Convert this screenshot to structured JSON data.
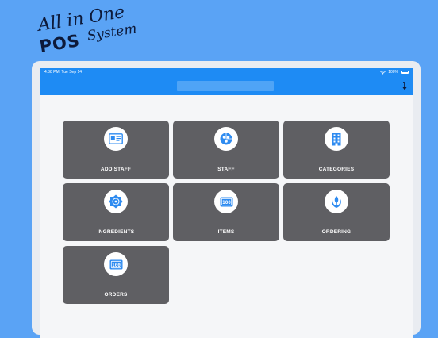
{
  "promo": {
    "line1": "All in One",
    "line2_bold": "POS",
    "line2_script": "System"
  },
  "status_bar": {
    "time": "4:38 PM",
    "date": "Tue Sep 14",
    "battery": "100%",
    "icons": [
      "wifi-icon",
      "battery-icon"
    ]
  },
  "header": {
    "title": "",
    "action_icon": "arrow-down-icon"
  },
  "colors": {
    "background": "#5AA3F5",
    "header": "#1E8BF4",
    "tile": "#5F5F63",
    "icon": "#2E8BF0"
  },
  "tiles": [
    {
      "label": "ADD STAFF",
      "icon": "id-card-icon"
    },
    {
      "label": "STAFF",
      "icon": "staff-pie-icon"
    },
    {
      "label": "CATEGORIES",
      "icon": "building-icon"
    },
    {
      "label": "INGREDIENTS",
      "icon": "ingredients-icon"
    },
    {
      "label": "ITEMS",
      "icon": "counter-100-icon"
    },
    {
      "label": "ORDERING",
      "icon": "ordering-icon"
    },
    {
      "label": "ORDERS",
      "icon": "counter-100-icon"
    }
  ]
}
